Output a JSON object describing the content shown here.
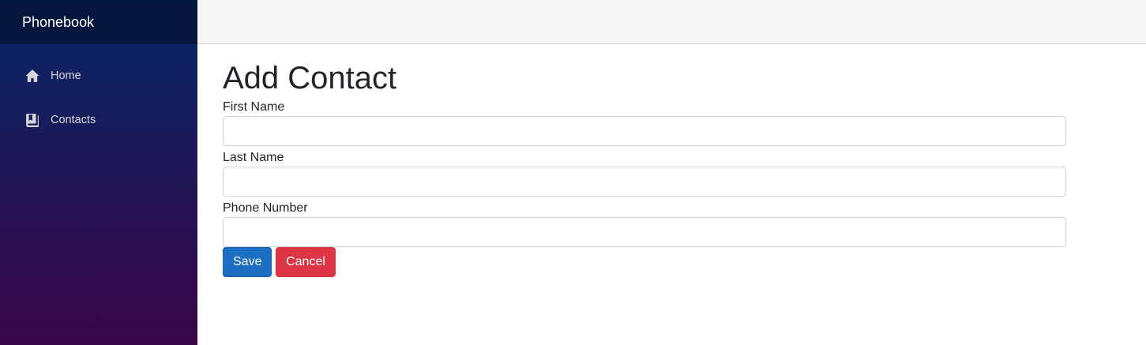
{
  "app": {
    "brand": "Phonebook"
  },
  "sidebar": {
    "items": [
      {
        "label": "Home",
        "icon": "home-icon"
      },
      {
        "label": "Contacts",
        "icon": "book-icon"
      }
    ]
  },
  "page": {
    "title": "Add Contact"
  },
  "form": {
    "first_name": {
      "label": "First Name",
      "value": ""
    },
    "last_name": {
      "label": "Last Name",
      "value": ""
    },
    "phone_number": {
      "label": "Phone Number",
      "value": ""
    },
    "save_label": "Save",
    "cancel_label": "Cancel"
  },
  "colors": {
    "sidebar_top": "#052767",
    "sidebar_bottom": "#3a0647",
    "primary": "#1b6ec2",
    "danger": "#dc3545"
  }
}
